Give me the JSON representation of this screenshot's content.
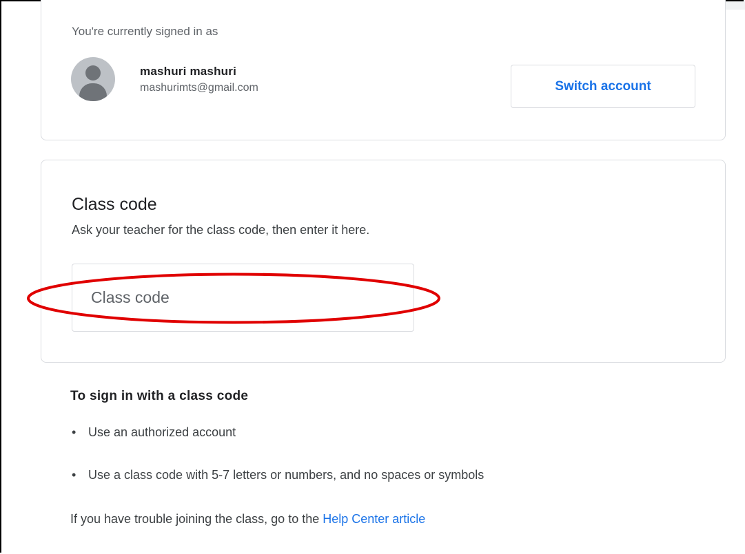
{
  "account": {
    "signed_in_label": "You're currently signed in as",
    "name": "mashuri mashuri",
    "email": "mashurimts@gmail.com",
    "switch_label": "Switch account",
    "avatar_icon": "person-icon"
  },
  "class_code": {
    "title": "Class code",
    "description": "Ask your teacher for the class code, then enter it here.",
    "input_placeholder": "Class code",
    "input_value": ""
  },
  "instructions": {
    "title": "To sign in with a class code",
    "bullets": [
      "Use an authorized account",
      "Use a class code with 5-7 letters or numbers, and no spaces or symbols"
    ],
    "help_prefix": "If you have trouble joining the class, go to the ",
    "help_link": "Help Center article"
  },
  "colors": {
    "accent": "#1a73e8",
    "annotation": "#e00000",
    "border": "#dadce0"
  }
}
